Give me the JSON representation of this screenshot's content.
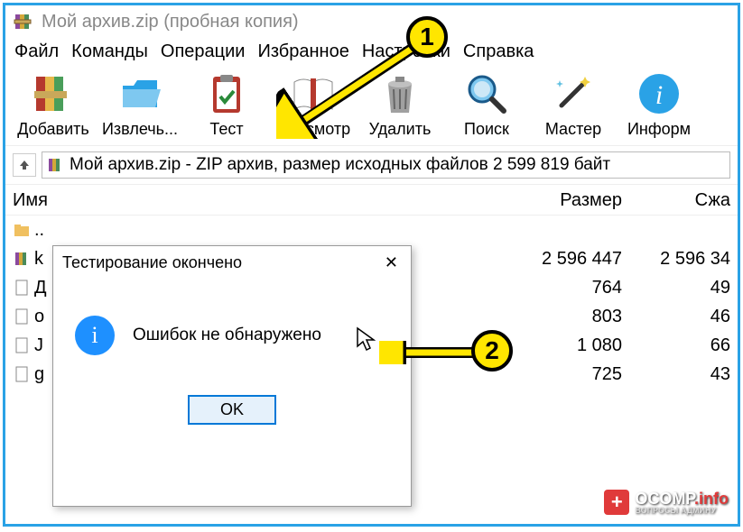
{
  "window": {
    "title": "Мой архив.zip (пробная копия)"
  },
  "menu": {
    "items": [
      "Файл",
      "Команды",
      "Операции",
      "Избранное",
      "Настройки",
      "Справка"
    ]
  },
  "toolbar": {
    "add": "Добавить",
    "extract": "Извлечь...",
    "test": "Тест",
    "view": "Просмотр",
    "delete": "Удалить",
    "find": "Поиск",
    "wizard": "Мастер",
    "info": "Информ"
  },
  "address": {
    "text": "Мой архив.zip - ZIP архив, размер исходных файлов 2 599 819 байт"
  },
  "columns": {
    "name": "Имя",
    "size": "Размер",
    "packed": "Сжа"
  },
  "rows": [
    {
      "name": "..",
      "size": "",
      "packed": ""
    },
    {
      "name": "k",
      "size": "2 596 447",
      "packed": "2 596 34"
    },
    {
      "name": "Д",
      "size": "764",
      "packed": "49"
    },
    {
      "name": "o",
      "size": "803",
      "packed": "46"
    },
    {
      "name": "J",
      "size": "1 080",
      "packed": "66"
    },
    {
      "name": "g",
      "size": "725",
      "packed": "43"
    }
  ],
  "dialog": {
    "title": "Тестирование окончено",
    "message": "Ошибок не обнаружено",
    "ok": "OK"
  },
  "markers": {
    "one": "1",
    "two": "2"
  },
  "watermark": {
    "brand": "OCOMP",
    "suffix": ".info",
    "sub": "ВОПРОСЫ АДМИНУ"
  }
}
